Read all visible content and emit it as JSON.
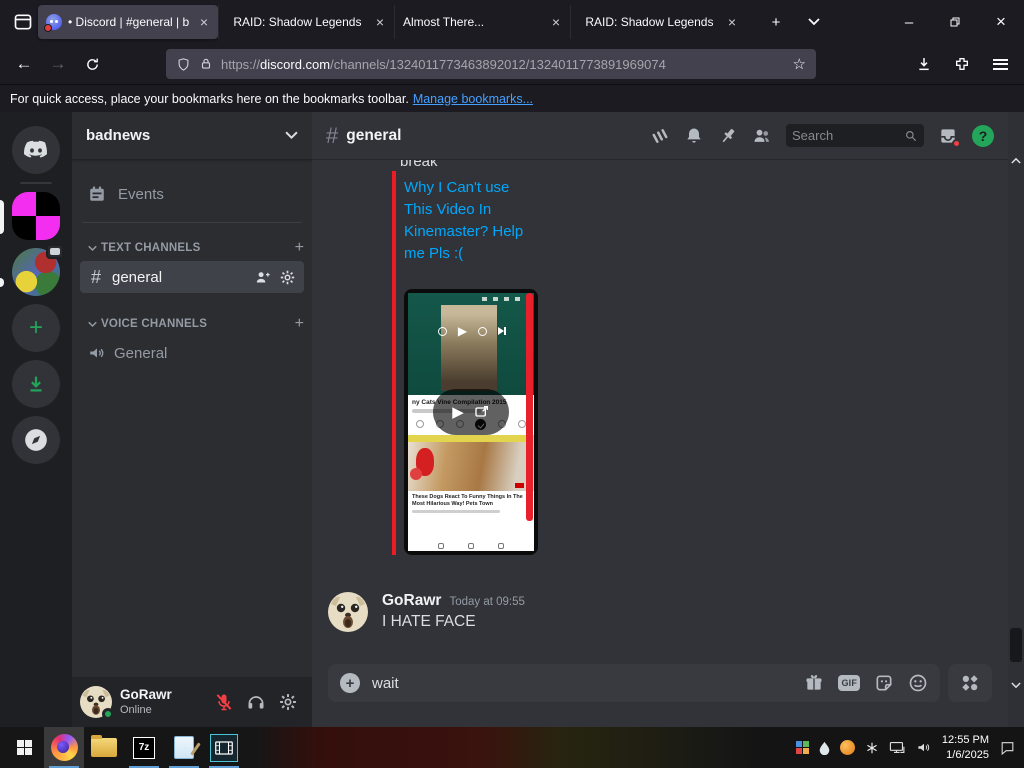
{
  "glyphs": {
    "close": "×",
    "minimize": "–",
    "new_tab": "+",
    "plus": "+",
    "hash": "#",
    "question": "?",
    "star": "☆",
    "play": "▶"
  },
  "colors": {
    "embed_border_red": "#ed1c24",
    "link_blue": "#00a8fc",
    "online_green": "#23a55a",
    "discord_bg": "#313338"
  },
  "browser": {
    "tabs": [
      {
        "title": "• Discord | #general | b"
      },
      {
        "title": "RAID: Shadow Legends"
      },
      {
        "title": "Almost There..."
      },
      {
        "title": "RAID: Shadow Legends"
      }
    ],
    "address": {
      "scheme": "https://",
      "host": "discord.com",
      "path": "/channels/1324011773463892012/1324011773891969074"
    },
    "bookmarks_notice": "For quick access, place your bookmarks here on the bookmarks toolbar.",
    "manage_bookmarks": "Manage bookmarks..."
  },
  "discord": {
    "server": {
      "name": "badnews"
    },
    "sidebar": {
      "events": "Events",
      "text_channels": "TEXT CHANNELS",
      "general_channel": "general",
      "voice_channels": "VOICE CHANNELS",
      "general_voice": "General"
    },
    "user_panel": {
      "username": "GoRawr",
      "status": "Online"
    },
    "chat_header": {
      "channel": "general",
      "search_placeholder": "Search"
    },
    "messages": {
      "clipped_text": "break",
      "embed_title_lines": [
        "Why I Can't use",
        "This Video In",
        "Kinemaster? Help",
        "me Pls :("
      ],
      "video_thumb": {
        "title": "ny Cats Vine Compilation 2015",
        "suggested_line1": "These Dogs React To Funny Things In The",
        "suggested_line2": "Most Hilarious Way! Pets Town"
      },
      "message": {
        "author": "GoRawr",
        "timestamp": "Today at 09:55",
        "text": "I HATE FACE"
      }
    },
    "composer": {
      "draft": "wait",
      "gif_label": "GIF"
    }
  },
  "taskbar": {
    "time": "12:55 PM",
    "date": "1/6/2025",
    "seven_zip_label": "7z"
  }
}
